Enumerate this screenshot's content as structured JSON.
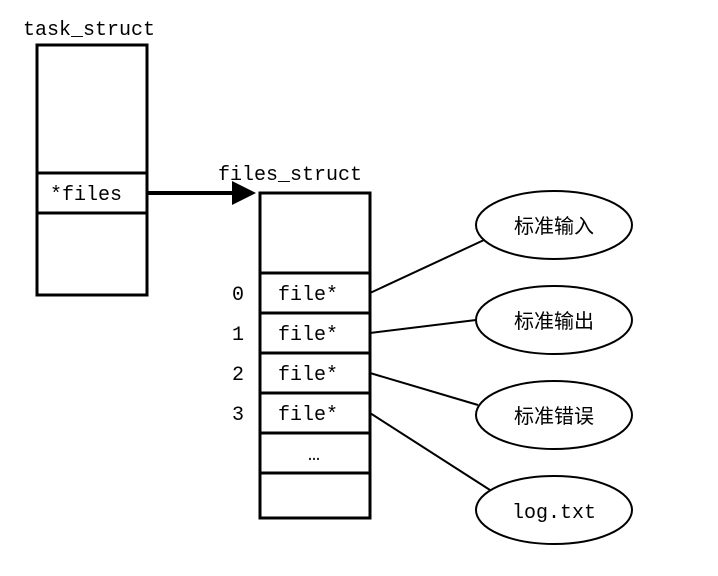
{
  "title_task_struct": "task_struct",
  "files_field": "*files",
  "title_files_struct": "files_struct",
  "fd_indices": [
    "0",
    "1",
    "2",
    "3"
  ],
  "fd_entries": [
    "file*",
    "file*",
    "file*",
    "file*",
    "…"
  ],
  "descriptors": [
    "标准输入",
    "标准输出",
    "标准错误",
    "log.txt"
  ]
}
